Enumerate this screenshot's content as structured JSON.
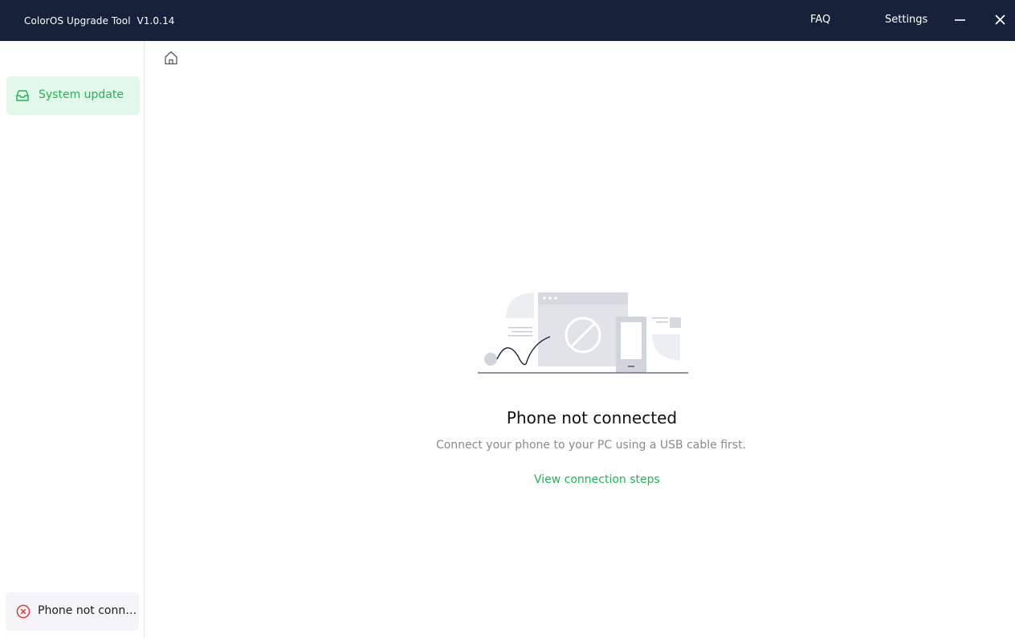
{
  "app": {
    "title": "ColorOS Upgrade Tool  V1.0.14"
  },
  "topbar": {
    "faq_label": "FAQ",
    "settings_label": "Settings"
  },
  "sidebar": {
    "items": [
      {
        "label": "System update",
        "icon": "inbox-icon",
        "active": true
      }
    ],
    "status": {
      "label": "Phone not connected",
      "icon": "error-circle-icon",
      "color": "#e5393f"
    }
  },
  "main": {
    "headline": "Phone not connected",
    "subtext": "Connect your phone to your PC using a USB cable first.",
    "link_label": "View connection steps"
  },
  "colors": {
    "titlebar": "#18213a",
    "accent": "#27b257",
    "accent_bg": "#e2f8ea"
  }
}
